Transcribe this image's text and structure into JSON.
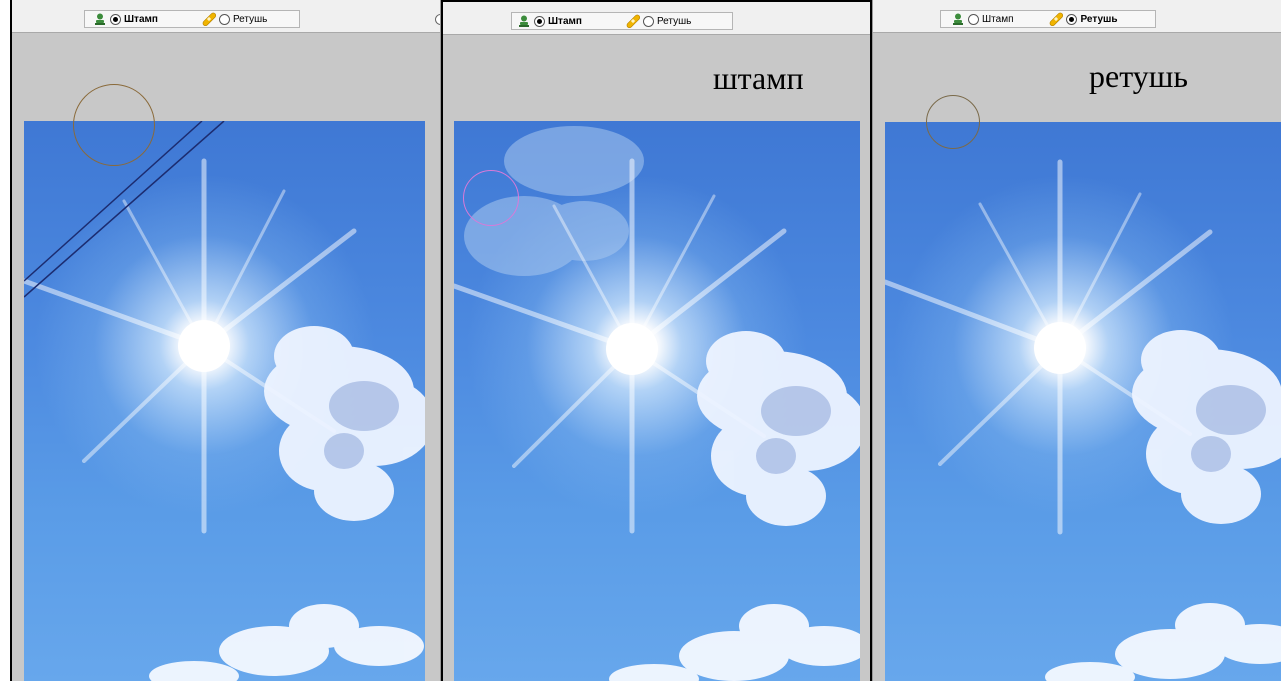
{
  "options": {
    "stamp_label": "Штамп",
    "retouch_label": "Ретушь"
  },
  "panels": {
    "left": {
      "stamp_selected": true,
      "retouch_selected": false
    },
    "middle": {
      "stamp_selected": true,
      "retouch_selected": false,
      "caption": "штамп"
    },
    "right": {
      "stamp_selected": false,
      "retouch_selected": true,
      "caption": "ретушь"
    }
  },
  "icons": {
    "stamp": "stamp-icon",
    "retouch": "bandage-icon"
  },
  "colors": {
    "canvas_background": "#c8c8c8",
    "toolbar_background": "#f0f0f0",
    "sky_top": "#3f78d4",
    "sky_bottom": "#67a7ec",
    "stamp_icon": "#3c8c3c",
    "retouch_icon": "#f0b400",
    "brush_outline_left": "#8a6a3a",
    "brush_outline_middle": "#d87ad8",
    "brush_outline_right": "#7a6a4a",
    "wire": "#1c2c70"
  }
}
